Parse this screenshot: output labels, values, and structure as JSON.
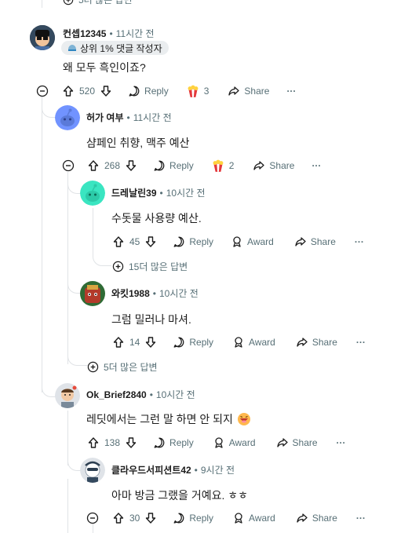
{
  "top_more": {
    "label": "5더 많은 답변"
  },
  "c1": {
    "username": "컨셉12345",
    "time": "11시간 전",
    "badge": "상위 1% 댓글 작성자",
    "text": "왜 모두 흑인이죠?",
    "votes": "520",
    "reply": "Reply",
    "award_count": "3",
    "share": "Share",
    "more": "···"
  },
  "c2": {
    "username": "허가 여부",
    "time": "11시간 전",
    "text": "샴페인 취향, 맥주 예산",
    "votes": "268",
    "reply": "Reply",
    "award_count": "2",
    "share": "Share",
    "more": "···"
  },
  "c3": {
    "username": "드레날린39",
    "time": "10시간 전",
    "text": "수돗물 사용량 예산.",
    "votes": "45",
    "reply": "Reply",
    "award": "Award",
    "share": "Share",
    "more": "···",
    "more_replies": "15더 많은 답변"
  },
  "c4": {
    "username": "와킷1988",
    "time": "10시간 전",
    "text": "그럼 밀러나 마셔.",
    "votes": "14",
    "reply": "Reply",
    "award": "Award",
    "share": "Share",
    "more": "···"
  },
  "c2_more": {
    "label": "5더 많은 답변"
  },
  "c5": {
    "username": "Ok_Brief2840",
    "time": "10시간 전",
    "text": "레딧에서는 그런 말 하면 안 되지",
    "votes": "138",
    "reply": "Reply",
    "award": "Award",
    "share": "Share",
    "more": "···"
  },
  "c6": {
    "username": "클라우드서피션트42",
    "time": "9시간 전",
    "text": "아마 방금 그랬을 거예요. ㅎㅎ",
    "votes": "30",
    "reply": "Reply",
    "award": "Award",
    "share": "Share",
    "more": "···"
  }
}
